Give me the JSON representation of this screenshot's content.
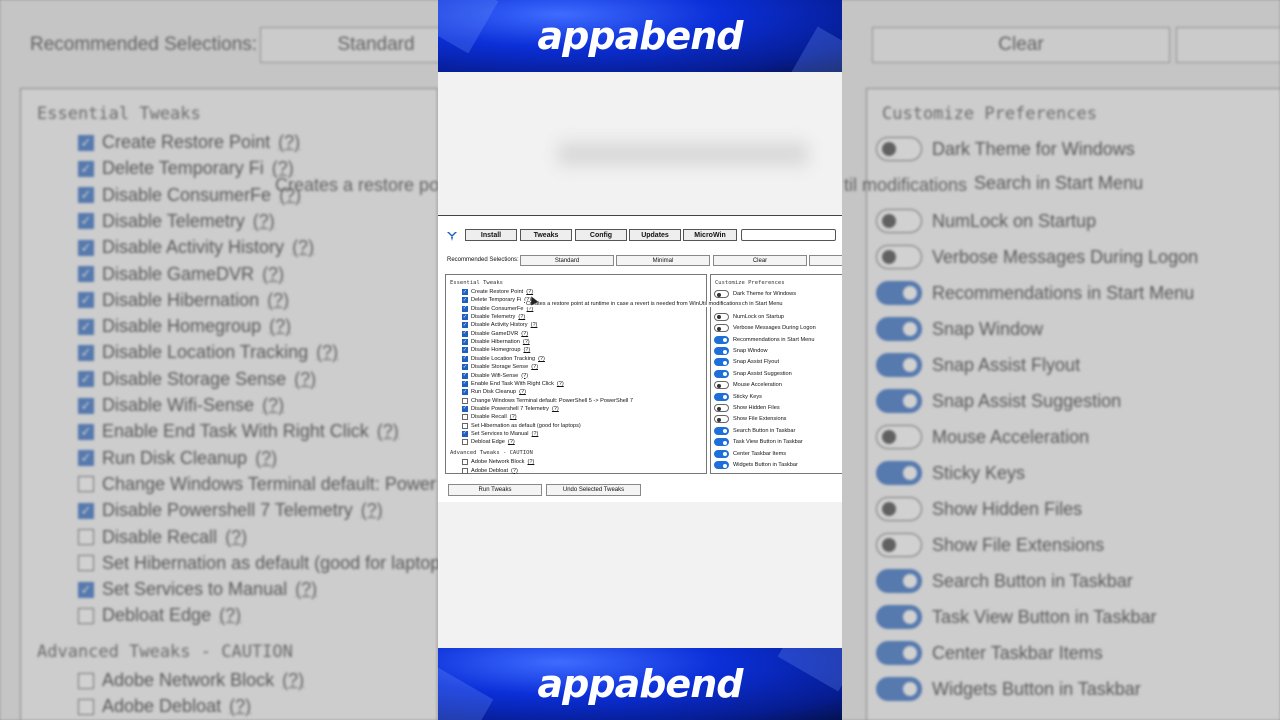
{
  "brand": "appabend",
  "app": {
    "nav": [
      "Install",
      "Tweaks",
      "Config",
      "Updates",
      "MicroWin"
    ],
    "search_placeholder": "",
    "recommended_label": "Recommended Selections:",
    "recommended_buttons": [
      "Standard",
      "Minimal",
      "Clear",
      ""
    ],
    "essential_title": "Essential Tweaks",
    "essential": [
      {
        "label": "Create Restore Point",
        "checked": true
      },
      {
        "label": "Delete Temporary Fi",
        "checked": true
      },
      {
        "label": "Disable ConsumerFe",
        "checked": true
      },
      {
        "label": "Disable Telemetry",
        "checked": true
      },
      {
        "label": "Disable Activity History",
        "checked": true
      },
      {
        "label": "Disable GameDVR",
        "checked": true
      },
      {
        "label": "Disable Hibernation",
        "checked": true
      },
      {
        "label": "Disable Homegroup",
        "checked": true
      },
      {
        "label": "Disable Location Tracking",
        "checked": true
      },
      {
        "label": "Disable Storage Sense",
        "checked": true
      },
      {
        "label": "Disable Wifi-Sense",
        "checked": true
      },
      {
        "label": "Enable End Task With Right Click",
        "checked": true
      },
      {
        "label": "Run Disk Cleanup",
        "checked": true
      },
      {
        "label": "Change Windows Terminal default: PowerShell 5 -> PowerShell 7",
        "checked": false
      },
      {
        "label": "Disable Powershell 7 Telemetry",
        "checked": true
      },
      {
        "label": "Disable Recall",
        "checked": false
      },
      {
        "label": "Set Hibernation as default (good for laptops)",
        "checked": false
      },
      {
        "label": "Set Services to Manual",
        "checked": true
      },
      {
        "label": "Debloat Edge",
        "checked": false
      }
    ],
    "advanced_title": "Advanced Tweaks - CAUTION",
    "advanced": [
      {
        "label": "Adobe Network Block",
        "checked": false
      },
      {
        "label": "Adobe Debloat",
        "checked": false
      }
    ],
    "help_mark": "(?)",
    "tooltip": "Creates a restore point at runtime in case a revert is needed from WinUtil modifications",
    "preferences_title": "Customize Preferences",
    "preferences": [
      {
        "label": "Dark Theme for Windows",
        "on": false
      },
      {
        "label": "Search in Start Menu",
        "on": null
      },
      {
        "label": "NumLock on Startup",
        "on": false
      },
      {
        "label": "Verbose Messages During Logon",
        "on": false
      },
      {
        "label": "Recommendations in Start Menu",
        "on": true
      },
      {
        "label": "Snap Window",
        "on": true
      },
      {
        "label": "Snap Assist Flyout",
        "on": true
      },
      {
        "label": "Snap Assist Suggestion",
        "on": true
      },
      {
        "label": "Mouse Acceleration",
        "on": false
      },
      {
        "label": "Sticky Keys",
        "on": true
      },
      {
        "label": "Show Hidden Files",
        "on": false
      },
      {
        "label": "Show File Extensions",
        "on": false
      },
      {
        "label": "Search Button in Taskbar",
        "on": true
      },
      {
        "label": "Task View Button in Taskbar",
        "on": true
      },
      {
        "label": "Center Taskbar Items",
        "on": true
      },
      {
        "label": "Widgets Button in Taskbar",
        "on": true
      }
    ],
    "run_button": "Run Tweaks",
    "undo_button": "Undo Selected Tweaks"
  },
  "background": {
    "recommended_label": "Recommended Selections:",
    "buttons": [
      "Standard",
      "Clear"
    ],
    "tooltip_fragment_left": "Creates a restore po",
    "tooltip_fragment_right": "til modifications",
    "essential_title": "Essential Tweaks",
    "essential": [
      {
        "label": "Create Restore Point",
        "checked": true
      },
      {
        "label": "Delete Temporary Fi",
        "checked": true
      },
      {
        "label": "Disable ConsumerFe",
        "checked": true
      },
      {
        "label": "Disable Telemetry",
        "checked": true
      },
      {
        "label": "Disable Activity History",
        "checked": true
      },
      {
        "label": "Disable GameDVR",
        "checked": true
      },
      {
        "label": "Disable Hibernation",
        "checked": true
      },
      {
        "label": "Disable Homegroup",
        "checked": true
      },
      {
        "label": "Disable Location Tracking",
        "checked": true
      },
      {
        "label": "Disable Storage Sense",
        "checked": true
      },
      {
        "label": "Disable Wifi-Sense",
        "checked": true
      },
      {
        "label": "Enable End Task With Right Click",
        "checked": true
      },
      {
        "label": "Run Disk Cleanup",
        "checked": true
      },
      {
        "label": "Change Windows Terminal default: Power",
        "checked": false
      },
      {
        "label": "Disable Powershell 7 Telemetry",
        "checked": true
      },
      {
        "label": "Disable Recall",
        "checked": false
      },
      {
        "label": "Set Hibernation as default (good for laptop",
        "checked": false
      },
      {
        "label": "Set Services to Manual",
        "checked": true
      },
      {
        "label": "Debloat Edge",
        "checked": false
      }
    ],
    "advanced_title": "Advanced Tweaks - CAUTION",
    "advanced": [
      {
        "label": "Adobe Network Block",
        "checked": false
      },
      {
        "label": "Adobe Debloat",
        "checked": false
      }
    ],
    "preferences_title": "Customize Preferences",
    "preferences": [
      {
        "label": "Dark Theme for Windows",
        "on": false
      },
      {
        "label": "Search in Start Menu",
        "on": null
      },
      {
        "label": "NumLock on Startup",
        "on": false
      },
      {
        "label": "Verbose Messages During Logon",
        "on": false
      },
      {
        "label": "Recommendations in Start Menu",
        "on": true
      },
      {
        "label": "Snap Window",
        "on": true
      },
      {
        "label": "Snap Assist Flyout",
        "on": true
      },
      {
        "label": "Snap Assist Suggestion",
        "on": true
      },
      {
        "label": "Mouse Acceleration",
        "on": false
      },
      {
        "label": "Sticky Keys",
        "on": true
      },
      {
        "label": "Show Hidden Files",
        "on": false
      },
      {
        "label": "Show File Extensions",
        "on": false
      },
      {
        "label": "Search Button in Taskbar",
        "on": true
      },
      {
        "label": "Task View Button in Taskbar",
        "on": true
      },
      {
        "label": "Center Taskbar Items",
        "on": true
      },
      {
        "label": "Widgets Button in Taskbar",
        "on": true
      }
    ]
  },
  "colors": {
    "accent": "#1f5fbf",
    "banner": "#0b2fd8"
  }
}
